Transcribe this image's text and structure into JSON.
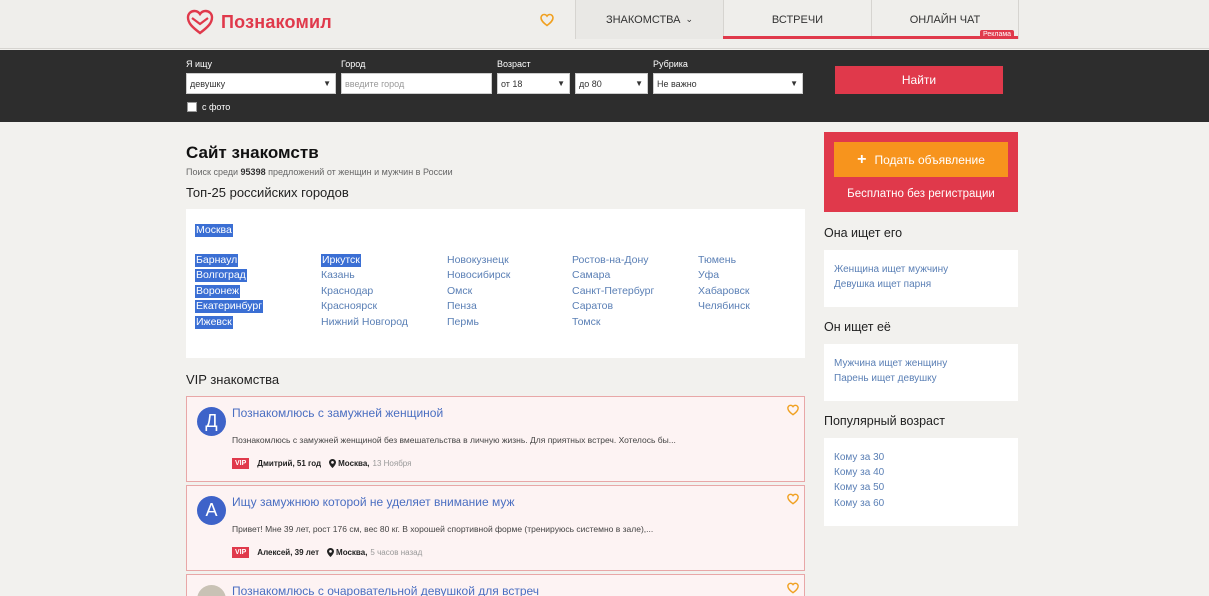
{
  "header": {
    "logo_text": "Познакомил",
    "nav": [
      {
        "label": "Знакомства"
      },
      {
        "label": "Встречи"
      },
      {
        "label": "Онлайн чат"
      }
    ],
    "ad_badge": "Реклама",
    "brand_color": "#e0394b"
  },
  "search": {
    "looking_for": {
      "label": "Я ищу",
      "value": "девушку"
    },
    "city": {
      "label": "Город",
      "placeholder": "введите город"
    },
    "age": {
      "label": "Возраст",
      "from": "от 18",
      "to": "до 80"
    },
    "category": {
      "label": "Рубрика",
      "value": "Не важно"
    },
    "with_photo": "с фото",
    "find_button": "Найти"
  },
  "main": {
    "title": "Сайт знакомств",
    "subtitle_pre": "Поиск среди ",
    "subtitle_count": "95398",
    "subtitle_post": " предложений от женщин и мужчин в России",
    "top_cities_title": "Топ-25 российских городов",
    "featured_city": "Москва",
    "city_columns": [
      [
        "Барнаул",
        "Волгоград",
        "Воронеж",
        "Екатеринбург",
        "Ижевск"
      ],
      [
        "Иркутск",
        "Казань",
        "Краснодар",
        "Красноярск",
        "Нижний Новгород"
      ],
      [
        "Новокузнецк",
        "Новосибирск",
        "Омск",
        "Пенза",
        "Пермь"
      ],
      [
        "Ростов-на-Дону",
        "Самара",
        "Санкт-Петербург",
        "Саратов",
        "Томск"
      ],
      [
        "Тюмень",
        "Уфа",
        "Хабаровск",
        "Челябинск"
      ]
    ],
    "vip_title": "VIP знакомства",
    "cards": [
      {
        "avatar": "Д",
        "title": "Познакомлюсь с замужней женщиной",
        "text": "Познакомлюсь с замужней женщиной без вмешательства в личную жизнь. Для приятных встреч. Хотелось бы...",
        "badge": "VIP",
        "name": "Дмитрий, 51 год",
        "city": "Москва,",
        "date": "13 Ноября"
      },
      {
        "avatar": "А",
        "title": "Ищу замужнюю которой не уделяет внимание муж",
        "text": "Привет! Мне 39 лет, рост 176 см, вес 80 кг. В хорошей спортивной форме (тренируюсь системно в зале),...",
        "badge": "VIP",
        "name": "Алексей, 39 лет",
        "city": "Москва,",
        "date": "5 часов назад"
      },
      {
        "avatar": "",
        "title": "Познакомлюсь с очаровательной девушкой для встреч",
        "text": "",
        "badge": "",
        "name": "",
        "city": "",
        "date": ""
      }
    ]
  },
  "sidebar": {
    "promo_button": "Подать объявление",
    "promo_sub": "Бесплатно без регистрации",
    "she_seeks": {
      "title": "Она ищет его",
      "links": [
        "Женщина ищет мужчину",
        "Девушка ищет парня"
      ]
    },
    "he_seeks": {
      "title": "Он ищет её",
      "links": [
        "Мужчина ищет женщину",
        "Парень ищет девушку"
      ]
    },
    "popular_age": {
      "title": "Популярный возраст",
      "links": [
        "Кому за 30",
        "Кому за 40",
        "Кому за 50",
        "Кому за 60"
      ]
    }
  }
}
